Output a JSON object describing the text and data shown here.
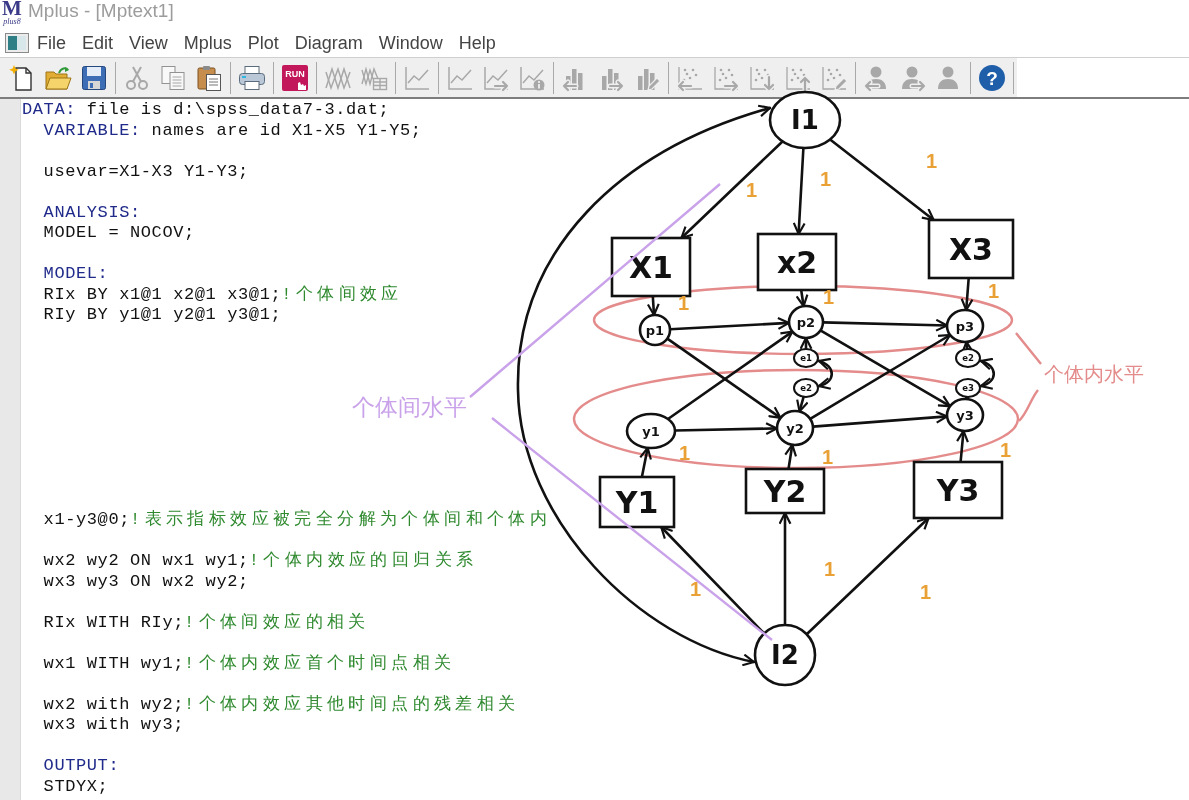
{
  "window": {
    "logo": {
      "mark": "M",
      "sub": "plus8"
    },
    "title": "Mplus - [Mptext1]",
    "active": false
  },
  "menu_bar": {
    "items": [
      "File",
      "Edit",
      "View",
      "Mplus",
      "Plot",
      "Diagram",
      "Window",
      "Help"
    ]
  },
  "toolbar": {
    "groups": [
      {
        "items": [
          {
            "kind": "new_file",
            "disabled": false
          },
          {
            "kind": "open_folder",
            "disabled": false
          },
          {
            "kind": "floppy_disk",
            "disabled": false
          }
        ]
      },
      {
        "items": [
          {
            "kind": "scissors",
            "disabled": true
          },
          {
            "kind": "copy_pages",
            "disabled": true
          },
          {
            "kind": "clipboard",
            "disabled": false
          }
        ]
      },
      {
        "items": [
          {
            "kind": "printer",
            "disabled": false
          }
        ]
      },
      {
        "items": [
          {
            "kind": "run",
            "label": "RUN",
            "disabled": false
          }
        ]
      },
      {
        "items": [
          {
            "kind": "zigzag_lines",
            "disabled": true
          },
          {
            "kind": "zigzag_table",
            "disabled": true
          }
        ]
      },
      {
        "items": [
          {
            "kind": "line_chart",
            "disabled": true
          }
        ]
      },
      {
        "items": [
          {
            "kind": "line_chart",
            "disabled": true
          },
          {
            "kind": "line_chart_arrow",
            "disabled": true
          },
          {
            "kind": "line_chart_info",
            "disabled": true
          }
        ]
      },
      {
        "items": [
          {
            "kind": "bar_chart_arrow_left",
            "disabled": true
          },
          {
            "kind": "bar_chart_arrow_right",
            "disabled": true
          },
          {
            "kind": "bar_chart_pencil",
            "disabled": true
          }
        ]
      },
      {
        "items": [
          {
            "kind": "scatter_arrow_left",
            "disabled": true
          },
          {
            "kind": "scatter_arrow_right",
            "disabled": true
          },
          {
            "kind": "scatter_arrow_down",
            "disabled": true
          },
          {
            "kind": "scatter_arrow_up",
            "disabled": true
          },
          {
            "kind": "scatter_pencil",
            "disabled": true
          }
        ]
      },
      {
        "items": [
          {
            "kind": "person_arrow_left",
            "disabled": true
          },
          {
            "kind": "person_arrow_right",
            "disabled": true
          },
          {
            "kind": "person",
            "disabled": true
          }
        ]
      },
      {
        "items": [
          {
            "kind": "help",
            "label": "?",
            "disabled": false
          }
        ]
      }
    ]
  },
  "editor": {
    "lines": [
      {
        "indented": false,
        "segments": [
          {
            "kind": "keyword",
            "text": "DATA:"
          },
          {
            "kind": "code",
            "text": " file is d:\\spss_data7-3.dat;"
          }
        ]
      },
      {
        "indented": true,
        "segments": [
          {
            "kind": "keyword",
            "text": "VARIABLE:"
          },
          {
            "kind": "code",
            "text": " names are id X1-X5 Y1-Y5;"
          }
        ]
      },
      {
        "indented": true,
        "segments": [
          {
            "kind": "code",
            "text": "usevar=X1-X3 Y1-Y3;"
          }
        ]
      },
      {
        "indented": true,
        "segments": [
          {
            "kind": "keyword",
            "text": "ANALYSIS:"
          }
        ]
      },
      {
        "indented": true,
        "segments": [
          {
            "kind": "code",
            "text": "MODEL = NOCOV;"
          }
        ]
      },
      {
        "indented": true,
        "segments": [
          {
            "kind": "keyword",
            "text": "MODEL:"
          }
        ]
      },
      {
        "indented": true,
        "segments": [
          {
            "kind": "code",
            "text": "RIx BY x1@1 x2@1 x3@1;"
          },
          {
            "kind": "comment",
            "text": "!个体间效应"
          }
        ]
      },
      {
        "indented": true,
        "segments": [
          {
            "kind": "code",
            "text": "RIy BY y1@1 y2@1 y3@1;"
          }
        ]
      },
      {
        "indented": true,
        "segments": [
          {
            "kind": "code",
            "text": "x1-y3@0;"
          },
          {
            "kind": "comment",
            "text": "!表示指标效应被完全分解为个体间和个体内"
          }
        ]
      },
      {
        "indented": true,
        "segments": [
          {
            "kind": "code",
            "text": "wx2 wy2 ON wx1 wy1;"
          },
          {
            "kind": "comment",
            "text": "!个体内效应的回归关系"
          }
        ]
      },
      {
        "indented": true,
        "segments": [
          {
            "kind": "code",
            "text": "wx3 wy3 ON wx2 wy2;"
          }
        ]
      },
      {
        "indented": true,
        "segments": [
          {
            "kind": "code",
            "text": "RIx WITH RIy;"
          },
          {
            "kind": "comment",
            "text": "!个体间效应的相关"
          }
        ]
      },
      {
        "indented": true,
        "segments": [
          {
            "kind": "code",
            "text": "wx1 WITH wy1;"
          },
          {
            "kind": "comment",
            "text": "!个体内效应首个时间点相关"
          }
        ]
      },
      {
        "indented": true,
        "segments": [
          {
            "kind": "code",
            "text": "wx2 with wy2;"
          },
          {
            "kind": "comment",
            "text": "!个体内效应其他时间点的残差相关"
          }
        ]
      },
      {
        "indented": true,
        "segments": [
          {
            "kind": "code",
            "text": "wx3 with wy3;"
          }
        ]
      },
      {
        "indented": true,
        "segments": [
          {
            "kind": "keyword",
            "text": "OUTPUT:"
          }
        ]
      },
      {
        "indented": true,
        "segments": [
          {
            "kind": "code",
            "text": "STDYX;"
          }
        ]
      }
    ]
  },
  "diagram": {
    "nodes": [
      {
        "label": "I1",
        "kind": "ellipse"
      },
      {
        "label": "X1",
        "kind": "box"
      },
      {
        "label": "x2",
        "kind": "box"
      },
      {
        "label": "X3",
        "kind": "box"
      },
      {
        "label": "p1",
        "kind": "circle"
      },
      {
        "label": "p2",
        "kind": "circle"
      },
      {
        "label": "p3",
        "kind": "circle"
      },
      {
        "label": "e1",
        "kind": "small_circle"
      },
      {
        "label": "e2",
        "kind": "small_circle"
      },
      {
        "label": "e2",
        "kind": "small_circle"
      },
      {
        "label": "e3",
        "kind": "small_circle"
      },
      {
        "label": "y1",
        "kind": "circle"
      },
      {
        "label": "y2",
        "kind": "circle"
      },
      {
        "label": "y3",
        "kind": "circle"
      },
      {
        "label": "Y1",
        "kind": "box"
      },
      {
        "label": "Y2",
        "kind": "box"
      },
      {
        "label": "Y3",
        "kind": "box"
      },
      {
        "label": "I2",
        "kind": "ellipse"
      }
    ],
    "loading_labels": [
      "1",
      "1",
      "1",
      "1",
      "1",
      "1",
      "1",
      "1",
      "1",
      "1",
      "1",
      "1"
    ],
    "annotations": [
      {
        "text": "个体内水平",
        "kind": "ellipses",
        "color": "#e48b8b"
      },
      {
        "text": "个体间水平",
        "kind": "lines",
        "color": "#c9a2ea"
      }
    ]
  }
}
